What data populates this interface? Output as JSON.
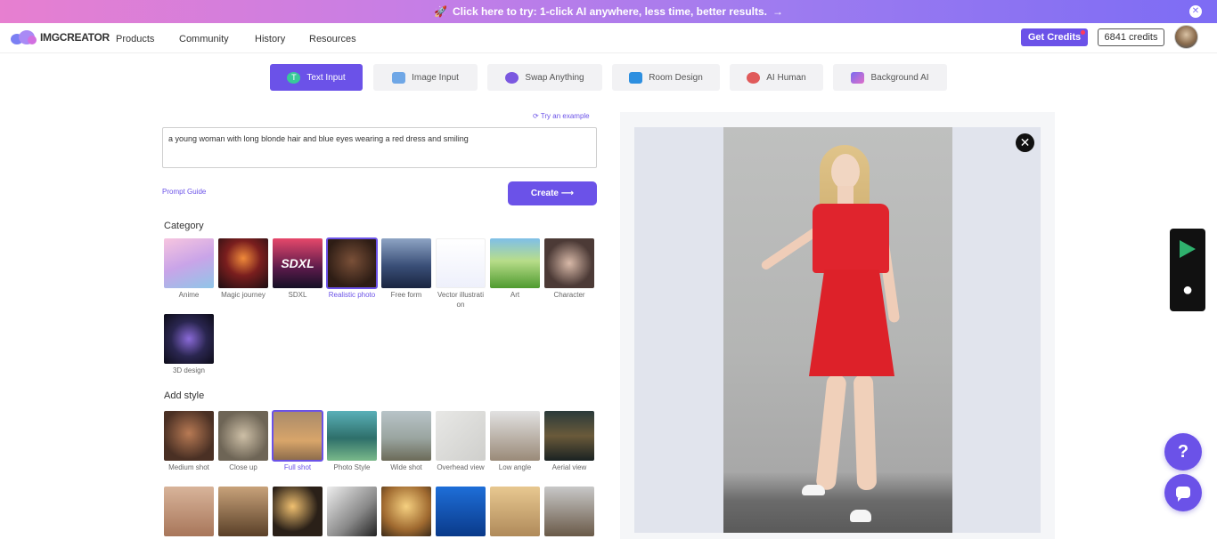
{
  "banner": {
    "text": "Click here to try: 1-click AI anywhere, less time, better results."
  },
  "nav": {
    "brand": "IMGCREATOR",
    "items": [
      "Products",
      "Community",
      "History",
      "Resources"
    ],
    "get_credits": "Get Credits",
    "credits": "6841 credits"
  },
  "tabs": [
    {
      "label": "Text Input",
      "icon": "text-t-icon",
      "active": true
    },
    {
      "label": "Image Input",
      "icon": "image-icon"
    },
    {
      "label": "Swap Anything",
      "icon": "swap-icon"
    },
    {
      "label": "Room Design",
      "icon": "house-icon"
    },
    {
      "label": "AI Human",
      "icon": "human-icon"
    },
    {
      "label": "Background AI",
      "icon": "background-icon"
    }
  ],
  "form": {
    "try_example": "Try an example",
    "prompt": "a young woman with long blonde hair and blue eyes wearing a red dress and smiling",
    "prompt_guide": "Prompt Guide",
    "create": "Create"
  },
  "category": {
    "title": "Category",
    "items": [
      "Anime",
      "Magic journey",
      "SDXL",
      "Realistic photo",
      "Free form",
      "Vector illustration",
      "Art",
      "Character",
      "3D design"
    ],
    "selected": "Realistic photo"
  },
  "style": {
    "title": "Add style",
    "items": [
      "Medium shot",
      "Close up",
      "Full shot",
      "Photo Style",
      "Wide shot",
      "Overhead view",
      "Low angle",
      "Aerial view"
    ],
    "selected": "Full shot",
    "row2_count_visible": 8
  },
  "colors": {
    "accent": "#6b52e8",
    "banner_start": "#e77fd0",
    "banner_end": "#7d6cf4"
  }
}
